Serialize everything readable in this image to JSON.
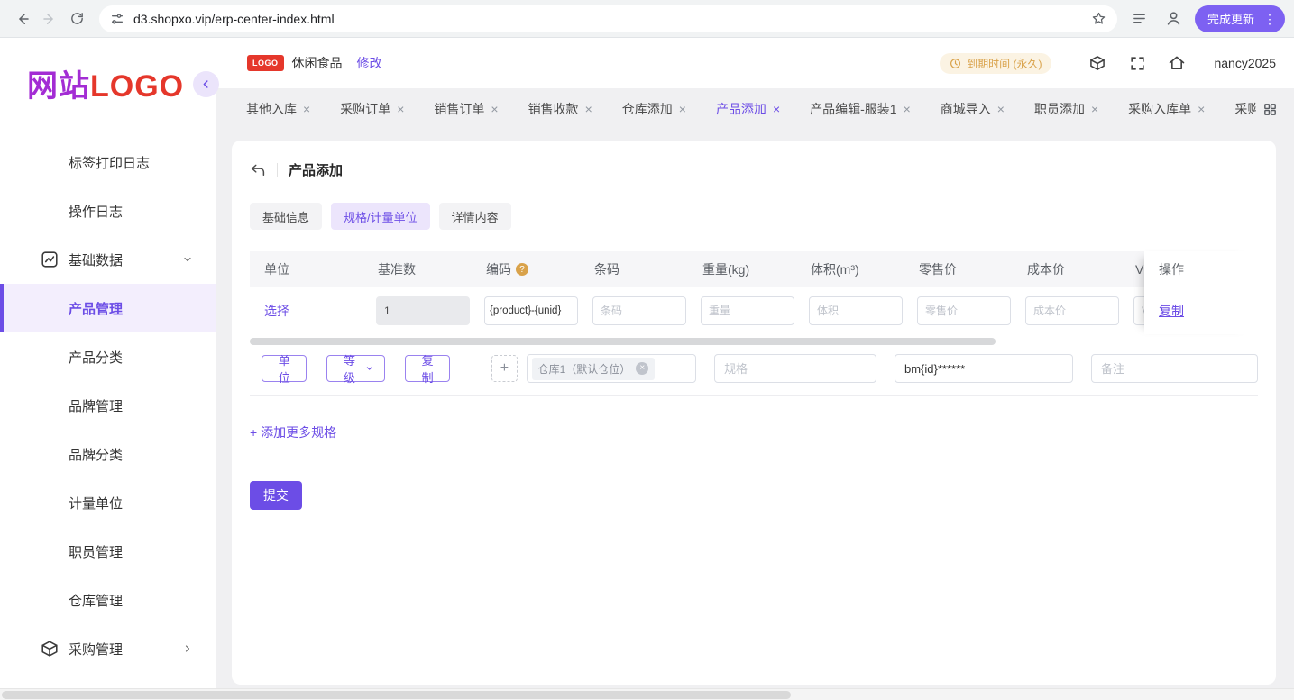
{
  "browser": {
    "url": "d3.shopxo.vip/erp-center-index.html",
    "update_button": "完成更新"
  },
  "icons": {
    "close": "×",
    "plus": "+",
    "kebab": "⋮",
    "help": "?"
  },
  "sidebar": {
    "logo_text_1": "网站",
    "logo_text_2": "LOGO",
    "items": [
      "标签打印日志",
      "操作日志",
      "基础数据",
      "产品管理",
      "产品分类",
      "品牌管理",
      "品牌分类",
      "计量单位",
      "职员管理",
      "仓库管理",
      "采购管理"
    ]
  },
  "header": {
    "logo_badge": "LOGO",
    "store_name": "休闲食品",
    "edit_link": "修改",
    "expire_badge": "到期时间 (永久)",
    "username": "nancy2025"
  },
  "tabbar": {
    "tabs": [
      "其他入库",
      "采购订单",
      "销售订单",
      "销售收款",
      "仓库添加",
      "产品添加",
      "产品编辑-服装1",
      "商城导入",
      "职员添加",
      "采购入库单",
      "采购"
    ]
  },
  "card": {
    "title": "产品添加",
    "tabs": [
      "基础信息",
      "规格/计量单位",
      "详情内容"
    ],
    "table": {
      "headers": [
        "单位",
        "基准数",
        "编码",
        "条码",
        "重量(kg)",
        "体积(m³)",
        "零售价",
        "成本价",
        "VIP价",
        "操作"
      ],
      "row": {
        "select": "选择",
        "base_qty": "1",
        "code": "{product}-{unid}",
        "barcode_ph": "条码",
        "weight_ph": "重量",
        "volume_ph": "体积",
        "retail_ph": "零售价",
        "cost_ph": "成本价",
        "vip_ph": "VIP价",
        "copy": "复制"
      }
    },
    "spec": {
      "unit_btn": "单位",
      "grade_btn": "等级",
      "copy_btn": "复制",
      "warehouse_tag": "仓库1（默认仓位）",
      "spec_ph": "规格",
      "code_value": "bm{id}******",
      "note_ph": "备注"
    },
    "add_more": "+ 添加更多规格",
    "submit": "提交"
  }
}
